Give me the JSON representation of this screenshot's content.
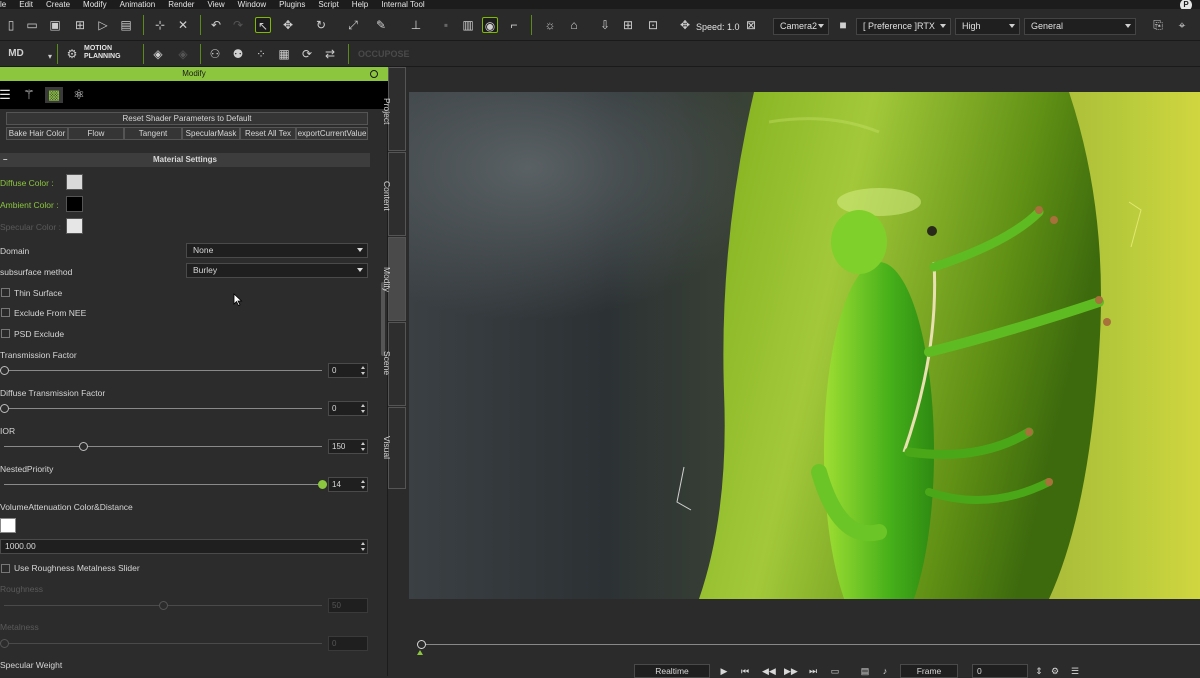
{
  "menu": [
    "le",
    "Edit",
    "Create",
    "Modify",
    "Animation",
    "Render",
    "View",
    "Window",
    "Plugins",
    "Script",
    "Help",
    "Internal Tool"
  ],
  "toolbar": {
    "speed_label": "Speed: 1.0",
    "camera": "Camera2",
    "preference": "[ Preference ]RTX",
    "quality": "High",
    "mode": "General",
    "motion_planning": [
      "MOTION",
      "PLANNING"
    ],
    "occupose": "OCCUPOSE",
    "md_logo": "MD"
  },
  "panel": {
    "title": "Modify",
    "reset_shader": "Reset Shader Parameters to Default",
    "buttons": [
      "Bake Hair Color",
      "Flow",
      "Tangent",
      "SpecularMask",
      "Reset All Tex",
      "exportCurrentValue"
    ],
    "section": "Material Settings",
    "colors": [
      {
        "label": "Diffuse Color :",
        "hex": "#d9d9d9"
      },
      {
        "label": "Ambient Color :",
        "hex": "#000000"
      },
      {
        "label": "Specular Color :",
        "hex": "#e6e6e6"
      }
    ],
    "domain_label": "Domain",
    "domain_value": "None",
    "subsurface_label": "subsurface method",
    "subsurface_value": "Burley",
    "checkboxes": [
      "Thin Surface",
      "Exclude From NEE",
      "PSD Exclude"
    ],
    "sliders": [
      {
        "label": "Transmission Factor",
        "value": "0",
        "fraction": 0.0
      },
      {
        "label": "Diffuse Transmission Factor",
        "value": "0",
        "fraction": 0.0
      },
      {
        "label": "IOR",
        "value": "150",
        "fraction": 0.25
      },
      {
        "label": "NestedPriority",
        "value": "14",
        "fraction": 1.0
      }
    ],
    "volume_label": "VolumeAttenuation Color&Distance",
    "volume_color": "#ffffff",
    "volume_distance": "1000.00",
    "roughness_check": "Use Roughness Metalness Slider",
    "dim_sliders": [
      {
        "label": "Roughness",
        "value": "50",
        "fraction": 0.5
      },
      {
        "label": "Metalness",
        "value": "0",
        "fraction": 0.0
      }
    ],
    "specular_weight": "Specular Weight"
  },
  "side_tabs": [
    "Project",
    "Content",
    "Modify",
    "Scene",
    "Visual"
  ],
  "timeline": {
    "realtime": "Realtime",
    "frame": "Frame",
    "frame_value": "0"
  },
  "accent_color": "#8cc63f"
}
